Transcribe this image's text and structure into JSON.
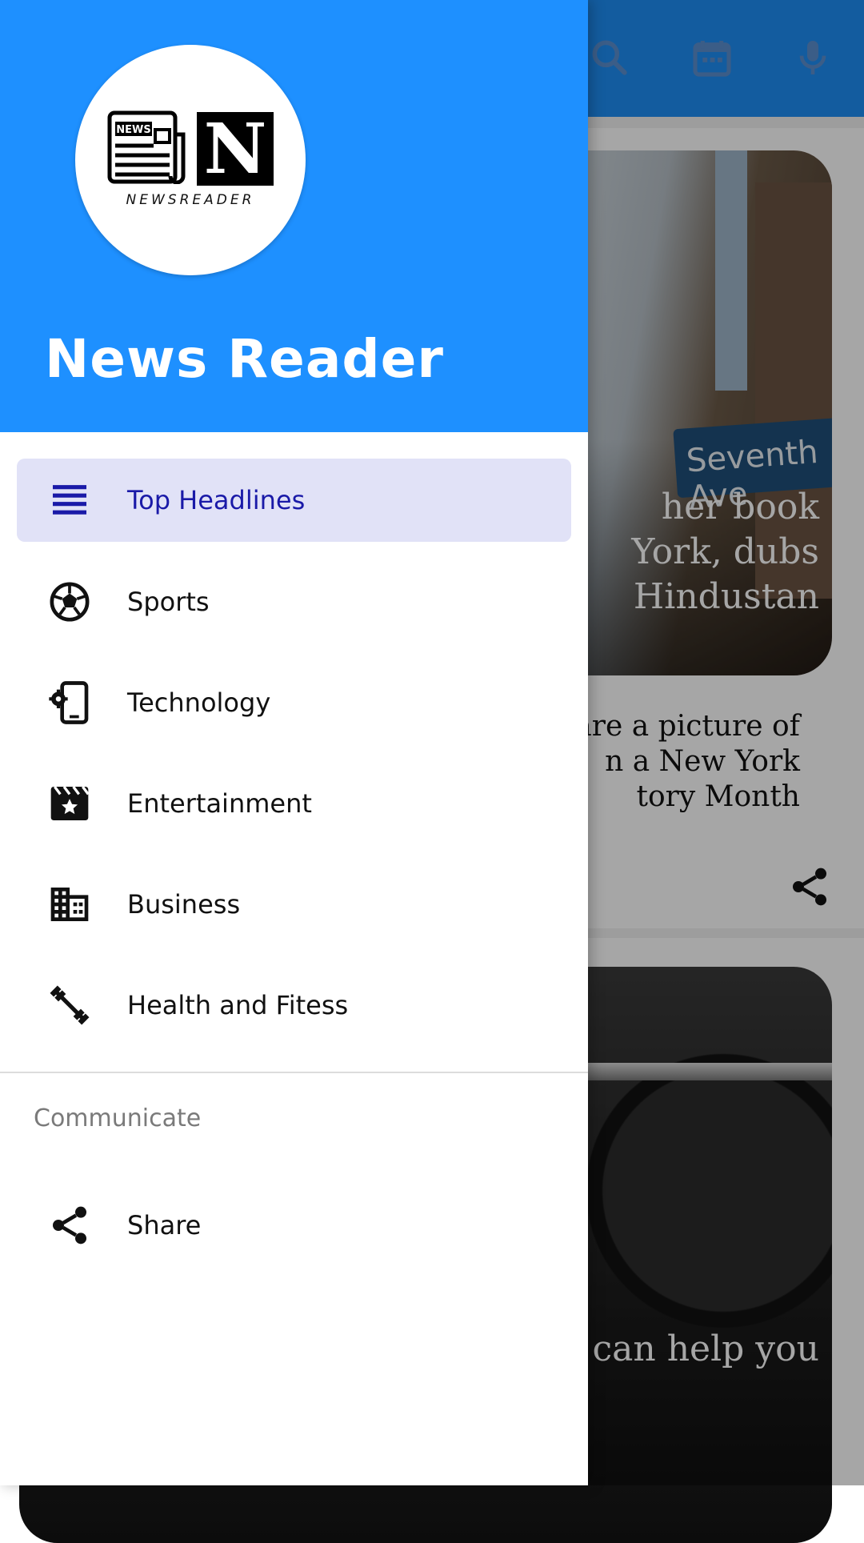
{
  "toolbar": {
    "icons": [
      "search-icon",
      "calendar-icon",
      "microphone-icon"
    ],
    "color": "#1e8ef5"
  },
  "feed": {
    "card1": {
      "image_title": "her book\nYork, dubs\nHindustan",
      "street_sign": "Seventh Ave",
      "description": "are a picture of\nn a New York\ntory Month"
    },
    "card2": {
      "image_title": "can help you"
    }
  },
  "drawer": {
    "header_color": "#1e90ff",
    "logo": {
      "badge_text": "NEWS",
      "letter": "N",
      "caption": "NEWSREADER"
    },
    "title": "News Reader",
    "items": [
      {
        "label": "Top Headlines",
        "icon": "list-icon",
        "active": true
      },
      {
        "label": "Sports",
        "icon": "soccer-ball-icon",
        "active": false
      },
      {
        "label": "Technology",
        "icon": "phone-settings-icon",
        "active": false
      },
      {
        "label": "Entertainment",
        "icon": "movie-clapper-icon",
        "active": false
      },
      {
        "label": "Business",
        "icon": "building-icon",
        "active": false
      },
      {
        "label": "Health and Fitess",
        "icon": "dumbbell-icon",
        "active": false
      }
    ],
    "section_title": "Communicate",
    "communicate_items": [
      {
        "label": "Share",
        "icon": "share-icon"
      }
    ],
    "active_color": "#1a1aa8",
    "active_bg": "#e1e2f7"
  }
}
